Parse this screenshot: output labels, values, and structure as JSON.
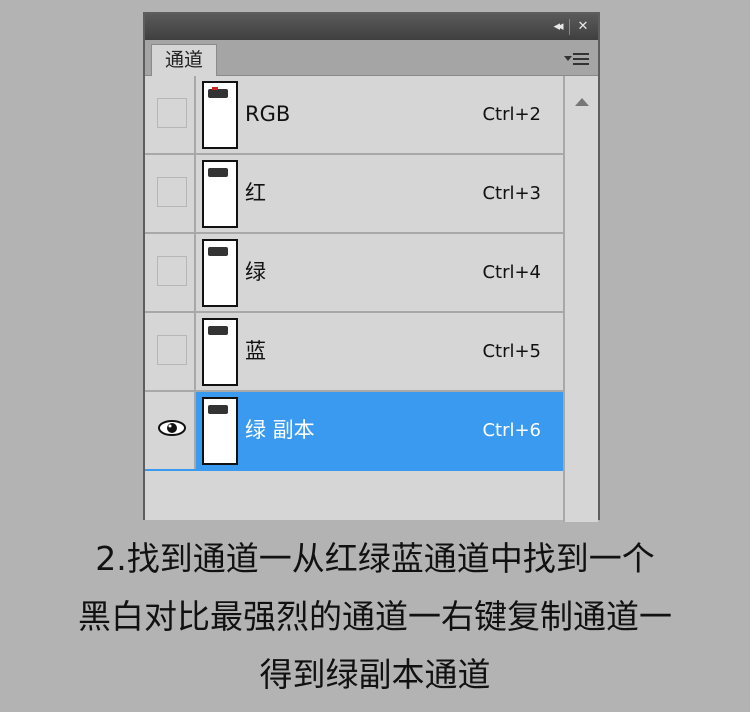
{
  "panel": {
    "tab_label": "通道",
    "buttons": {
      "collapse": "◂◂",
      "close": "✕"
    },
    "menu_icon": "panel-menu-icon"
  },
  "channels": [
    {
      "name": "RGB",
      "shortcut": "Ctrl+2",
      "visible": false,
      "selected": false
    },
    {
      "name": "红",
      "shortcut": "Ctrl+3",
      "visible": false,
      "selected": false
    },
    {
      "name": "绿",
      "shortcut": "Ctrl+4",
      "visible": false,
      "selected": false
    },
    {
      "name": "蓝",
      "shortcut": "Ctrl+5",
      "visible": false,
      "selected": false
    },
    {
      "name": "绿 副本",
      "shortcut": "Ctrl+6",
      "visible": true,
      "selected": true
    }
  ],
  "caption": {
    "line1": "2.找到通道一从红绿蓝通道中找到一个",
    "line2": "黑白对比最强烈的通道一右键复制通道一",
    "line3": "得到绿副本通道"
  },
  "colors": {
    "selection": "#3a9af0",
    "panel_bg": "#d6d6d6",
    "page_bg": "#b3b3b3"
  }
}
